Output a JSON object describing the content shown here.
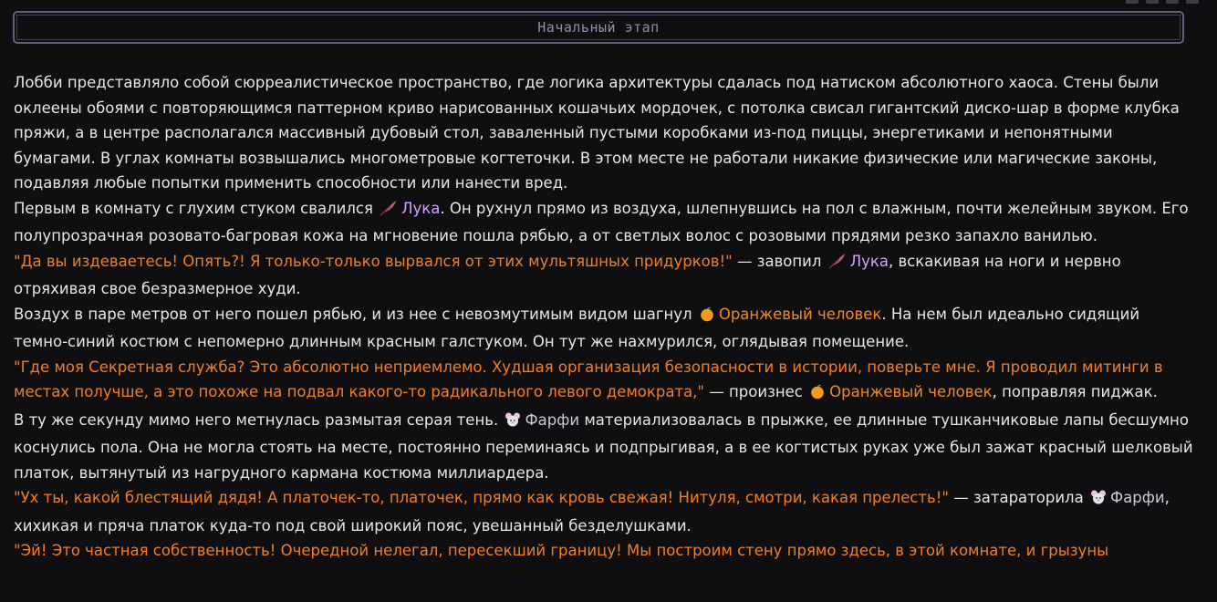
{
  "stage": {
    "title": "Начальный этап"
  },
  "characters": {
    "luka": {
      "name": "Лука",
      "icon": "feather-icon",
      "color": "#d1a3ff"
    },
    "orange": {
      "name": "Оранжевый человек",
      "icon": "orange-fruit-icon",
      "color": "#f08a1e"
    },
    "farfi": {
      "name": "Фарфи",
      "icon": "mouse-icon",
      "color": "#c7cad4"
    }
  },
  "colors": {
    "quote": "#f07f24",
    "text": "#e6e6e6",
    "background": "#0f0f12",
    "header_border": "#5b6275"
  },
  "story": {
    "p1": "Лобби представляло собой сюрреалистическое пространство, где логика архитектуры сдалась под натиском абсолютного хаоса. Стены были оклеены обоями с повторяющимся паттерном криво нарисованных кошачьих мордочек, с потолка свисал гигантский диско-шар в форме клубка пряжи, а в центре располагался массивный дубовый стол, заваленный пустыми коробками из-под пиццы, энергетиками и непонятными бумагами. В углах комнаты возвышались многометровые когтеточки. В этом месте не работали никакие физические или магические законы, подавляя любые попытки применить способности или нанести вред.",
    "p2_a": "Первым в комнату с глухим стуком свалился",
    "p2_b": ". Он рухнул прямо из воздуха, шлепнувшись на пол с влажным, почти желейным звуком. Его полупрозрачная розовато-багровая кожа на мгновение пошла рябью, а от светлых волос с розовыми прядями резко запахло ванилью.",
    "p3_quote": "\"Да вы издеваетесь! Опять?! Я только-только вырвался от этих мультяшных придурков!\"",
    "p3_a": " — завопил",
    "p3_b": ", вскакивая на ноги и нервно отряхивая свое безразмерное худи.",
    "p4_a": "Воздух в паре метров от него пошел рябью, и из нее с невозмутимым видом шагнул",
    "p4_b": ". На нем был идеально сидящий темно-синий костюм с непомерно длинным красным галстуком. Он тут же нахмурился, оглядывая помещение.",
    "p5_quote": "\"Где моя Секретная служба? Это абсолютно неприемлемо. Худшая организация безопасности в истории, поверьте мне. Я проводил митинги в местах получше, а это похоже на подвал какого-то радикального левого демократа,\"",
    "p5_a": " — произнес",
    "p5_b": ", поправляя пиджак.",
    "p6_a": "В ту же секунду мимо него метнулась размытая серая тень.",
    "p6_b": " материализовалась в прыжке, ее длинные тушканчиковые лапы бесшумно коснулись пола. Она не могла стоять на месте, постоянно переминаясь и подпрыгивая, а в ее когтистых руках уже был зажат красный шелковый платок, вытянутый из нагрудного кармана костюма миллиардера.",
    "p7_quote": "\"Ух ты, какой блестящий дядя! А платочек-то, платочек, прямо как кровь свежая! Нитуля, смотри, какая прелесть!\"",
    "p7_a": " — затараторила",
    "p7_b": ", хихикая и пряча платок куда-то под свой широкий пояс, увешанный безделушками.",
    "p8_quote": "\"Эй! Это частная собственность! Очередной нелегал, пересекший границу! Мы построим стену прямо здесь, в этой комнате, и грызуны"
  }
}
